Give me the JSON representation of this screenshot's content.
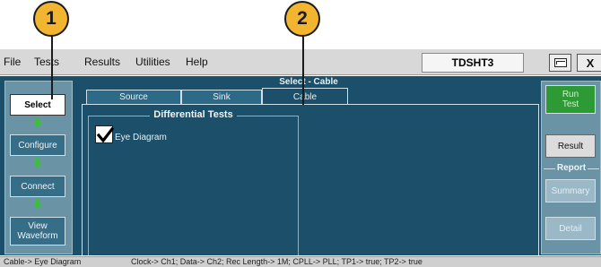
{
  "callouts": [
    "1",
    "2"
  ],
  "menu": [
    "File",
    "Tests",
    "Results",
    "Utilities",
    "Help"
  ],
  "app_name": "TDSHT3",
  "close_label": "X",
  "icons": {
    "monitor": "monitor-icon",
    "check": "checkmark-icon"
  },
  "left_nav": {
    "select": "Select",
    "configure": "Configure",
    "connect": "Connect",
    "view_waveform_1": "View",
    "view_waveform_2": "Waveform"
  },
  "panel_title": "Select - Cable",
  "tabs": [
    "Source",
    "Sink",
    "Cable"
  ],
  "group_title": "Differential Tests",
  "eye_diagram": {
    "label": "Eye Diagram",
    "checked": true
  },
  "right_nav": {
    "run_1": "Run",
    "run_2": "Test",
    "result": "Result",
    "report": "Report",
    "summary": "Summary",
    "detail": "Detail"
  },
  "status": {
    "left": "Cable-> Eye Diagram",
    "right": "Clock-> Ch1; Data-> Ch2; Rec Length-> 1M; CPLL-> PLL; TP1-> true; TP2-> true"
  },
  "colors": {
    "app_bg": "#1c4f69",
    "nav_bg": "#6a93a6",
    "callout": "#f2b52f",
    "run": "#2e9a36"
  }
}
